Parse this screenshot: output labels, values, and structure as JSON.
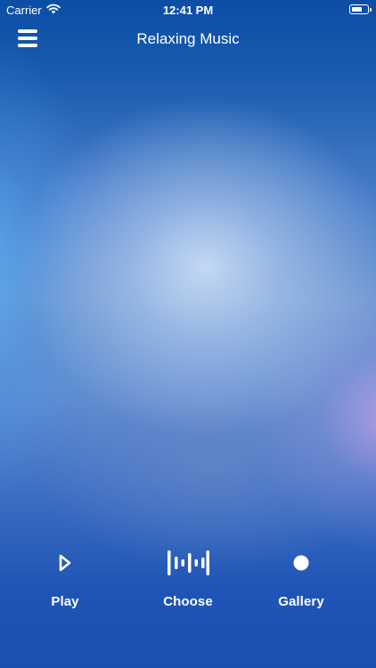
{
  "status_bar": {
    "carrier": "Carrier",
    "time": "12:41 PM",
    "wifi_icon": "wifi-icon",
    "battery_icon": "battery-icon"
  },
  "nav": {
    "title": "Relaxing Music",
    "menu_icon": "hamburger-menu-icon"
  },
  "toolbar": {
    "items": [
      {
        "label": "Play",
        "icon": "play-icon"
      },
      {
        "label": "Choose",
        "icon": "waveform-icon"
      },
      {
        "label": "Gallery",
        "icon": "dot-icon"
      }
    ]
  },
  "colors": {
    "top": "#0c4ea6",
    "center_glow": "#c8dcf5",
    "bottom": "#1b4fb2",
    "accent_purple": "#bea0e6",
    "text": "#ffffff"
  }
}
